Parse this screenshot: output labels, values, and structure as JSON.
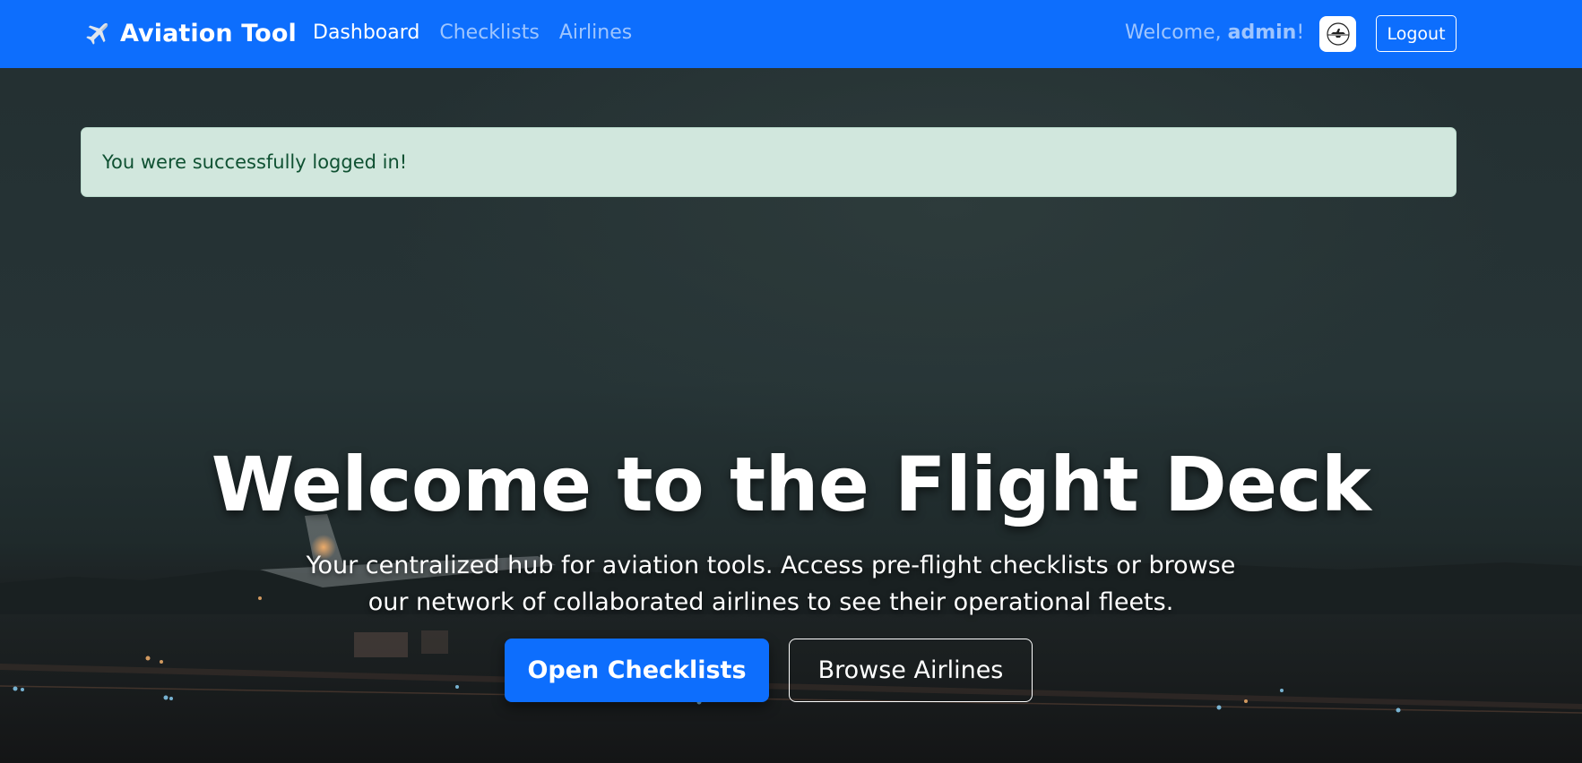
{
  "navbar": {
    "brand_icon": "airplane-icon",
    "brand_label": "Aviation Tool",
    "links": [
      {
        "label": "Dashboard",
        "active": true
      },
      {
        "label": "Checklists",
        "active": false
      },
      {
        "label": "Airlines",
        "active": false
      }
    ],
    "welcome_prefix": "Welcome, ",
    "welcome_user": "admin",
    "welcome_suffix": "!",
    "avatar_icon": "airline-logo-icon",
    "logout_label": "Logout"
  },
  "alert": {
    "message": "You were successfully logged in!"
  },
  "hero": {
    "title": "Welcome to the Flight Deck",
    "subtitle": "Your centralized hub for aviation tools. Access pre-flight checklists or browse our network of collaborated airlines to see their operational fleets.",
    "primary_button": "Open Checklists",
    "secondary_button": "Browse Airlines"
  },
  "colors": {
    "primary": "#0d6efd",
    "alert_bg": "#d1e7dd",
    "alert_text": "#0f5132"
  }
}
